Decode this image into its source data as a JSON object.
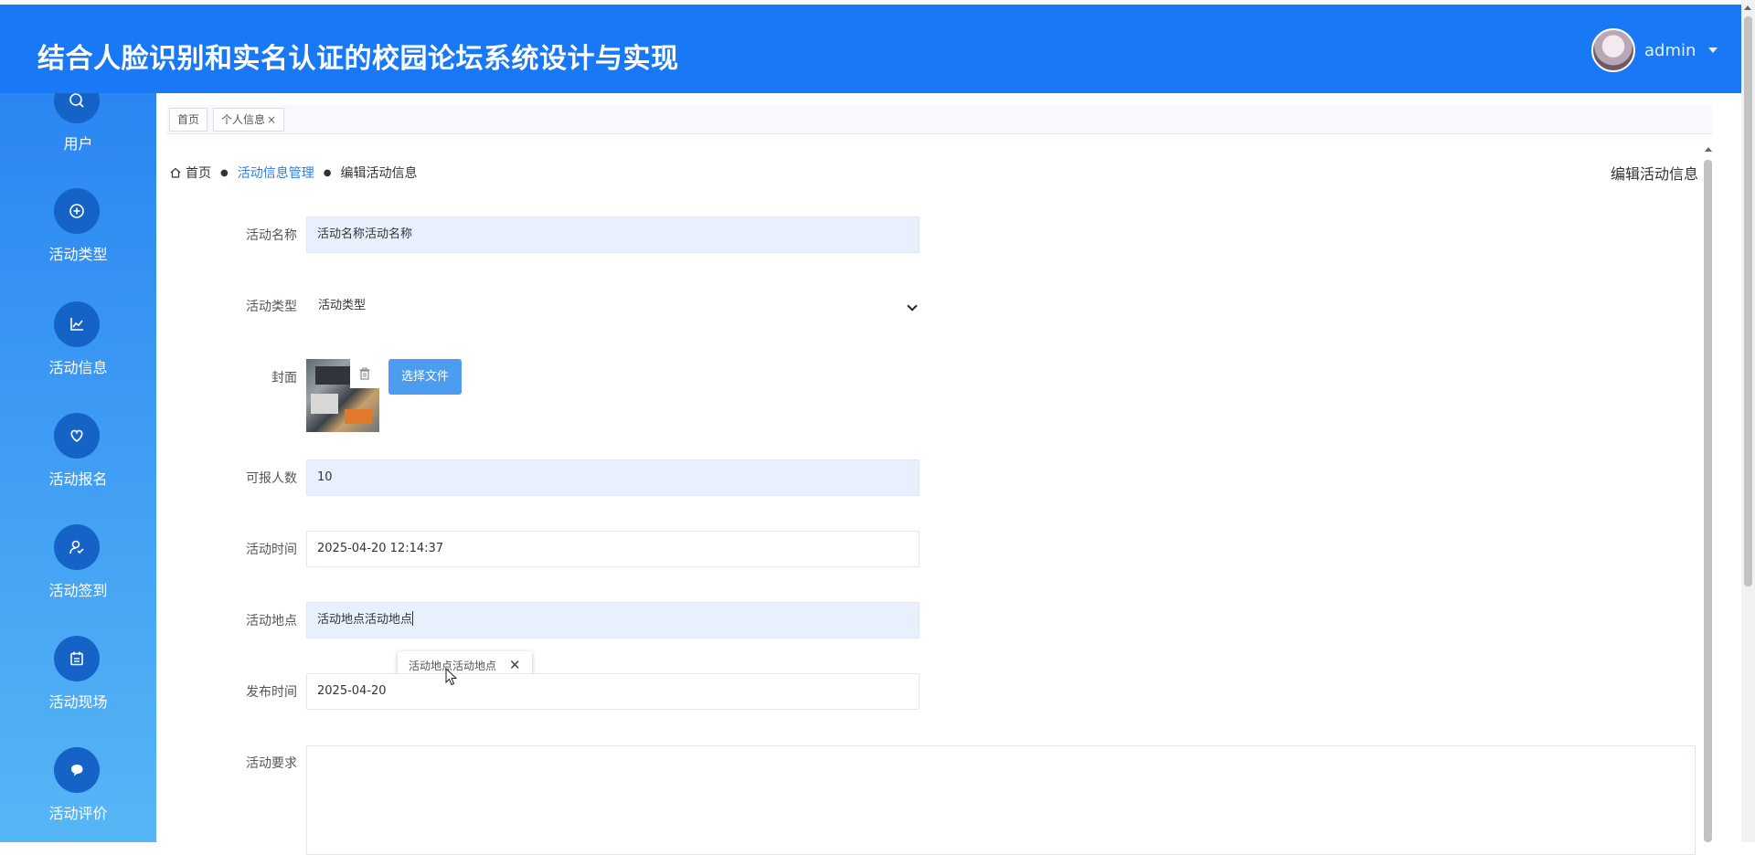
{
  "header": {
    "title": "结合人脸识别和实名认证的校园论坛系统设计与实现",
    "user_name": "admin",
    "bg_color": "#1978f5"
  },
  "sidebar": {
    "items": [
      {
        "label": "用户",
        "icon": "search-icon"
      },
      {
        "label": "活动类型",
        "icon": "plus-circle-icon"
      },
      {
        "label": "活动信息",
        "icon": "chart-icon"
      },
      {
        "label": "活动报名",
        "icon": "heart-icon"
      },
      {
        "label": "活动签到",
        "icon": "user-check-icon"
      },
      {
        "label": "活动现场",
        "icon": "calendar-icon"
      },
      {
        "label": "活动评价",
        "icon": "comment-icon"
      }
    ]
  },
  "tabs": [
    {
      "label": "首页"
    },
    {
      "label": "个人信息",
      "close": "×"
    }
  ],
  "breadcrumb": {
    "home": "首页",
    "parent": "活动信息管理",
    "current": "编辑活动信息",
    "separator": "●"
  },
  "page_heading": "编辑活动信息",
  "form": {
    "name_label": "活动名称",
    "name_value": "活动名称活动名称",
    "type_label": "活动类型",
    "type_value": "活动类型",
    "cover_label": "封面",
    "cover_button": "选择文件",
    "capacity_label": "可报人数",
    "capacity_value": "10",
    "time_label": "活动时间",
    "time_value": "2025-04-20 12:14:37",
    "location_label": "活动地点",
    "location_value": "活动地点活动地点",
    "publish_label": "发布时间",
    "publish_value": "2025-04-20",
    "requirement_label": "活动要求"
  },
  "autocomplete": {
    "suggestion": "活动地点活动地点",
    "close": "✕"
  }
}
